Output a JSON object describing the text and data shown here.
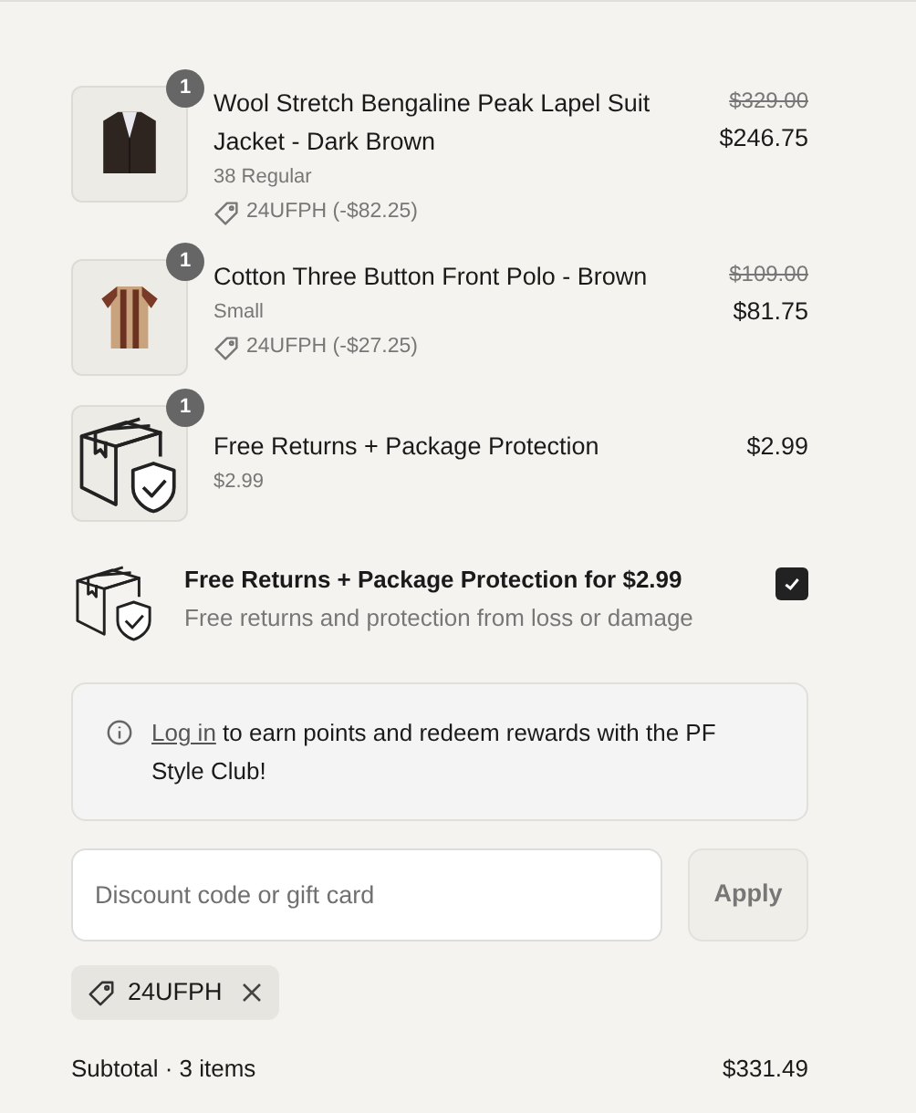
{
  "line_items": [
    {
      "kind": "jacket",
      "quantity": "1",
      "title": "Wool Stretch Bengaline Peak Lapel Suit Jacket - Dark Brown",
      "variant": "38 Regular",
      "discount": "24UFPH (-$82.25)",
      "original_price": "$329.00",
      "price": "$246.75"
    },
    {
      "kind": "polo",
      "quantity": "1",
      "title": "Cotton Three Button Front Polo - Brown",
      "variant": "Small",
      "discount": "24UFPH (-$27.25)",
      "original_price": "$109.00",
      "price": "$81.75"
    },
    {
      "kind": "protection",
      "quantity": "1",
      "title": "Free Returns + Package Protection",
      "variant": "$2.99",
      "price": "$2.99"
    }
  ],
  "protection_offer": {
    "title": "Free Returns + Package Protection for $2.99",
    "description": "Free returns and protection from loss or damage",
    "checked": true
  },
  "rewards_notice": {
    "link": "Log in",
    "text": " to earn points and redeem rewards with the PF Style Club!"
  },
  "discount": {
    "placeholder": "Discount code or gift card",
    "button": "Apply",
    "applied_code": "24UFPH"
  },
  "subtotal": {
    "label": "Subtotal · 3 items",
    "value": "$331.49"
  }
}
